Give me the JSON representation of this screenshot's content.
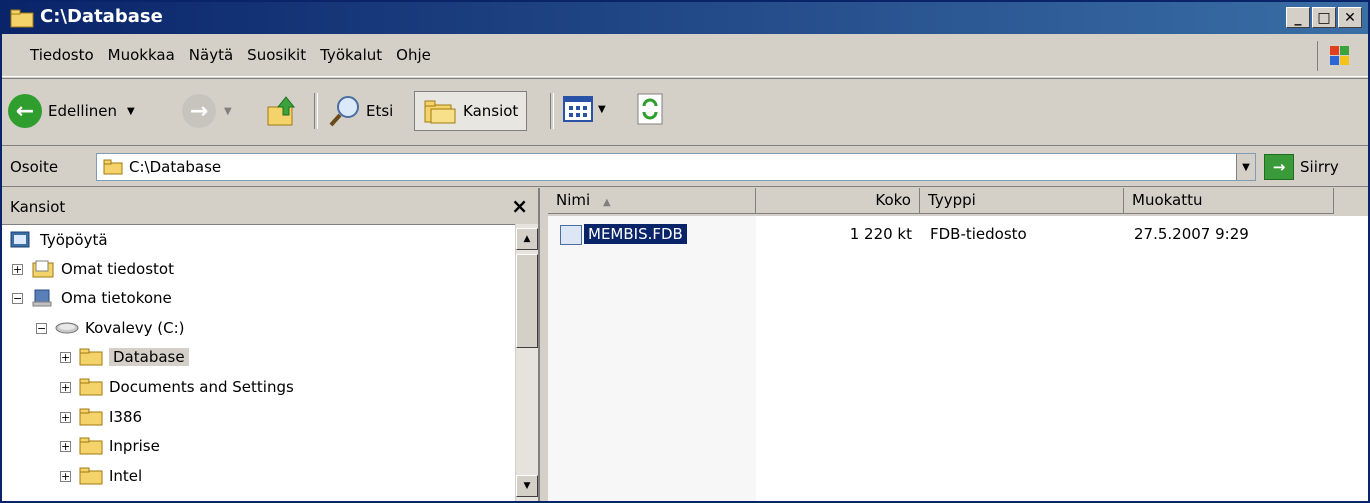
{
  "window": {
    "title": "C:\\Database"
  },
  "menu": [
    "Tiedosto",
    "Muokkaa",
    "Näytä",
    "Suosikit",
    "Työkalut",
    "Ohje"
  ],
  "toolbar": {
    "back_label": "Edellinen",
    "search_label": "Etsi",
    "folders_label": "Kansiot"
  },
  "address": {
    "label": "Osoite",
    "value": "C:\\Database",
    "go_label": "Siirry"
  },
  "folders_pane": {
    "title": "Kansiot",
    "tree": [
      {
        "label": "Työpöytä"
      },
      {
        "label": "Omat tiedostot"
      },
      {
        "label": "Oma tietokone"
      },
      {
        "label": "Kovalevy (C:)"
      },
      {
        "label": "Database"
      },
      {
        "label": "Documents and Settings"
      },
      {
        "label": "I386"
      },
      {
        "label": "Inprise"
      },
      {
        "label": "Intel"
      }
    ]
  },
  "list": {
    "columns": [
      "Nimi",
      "Koko",
      "Tyyppi",
      "Muokattu"
    ],
    "rows": [
      {
        "name": "MEMBIS.FDB",
        "size": "1 220 kt",
        "type": "FDB-tiedosto",
        "modified": "27.5.2007 9:29"
      }
    ]
  },
  "colors": {
    "title_bar": "#0a246a",
    "selection": "#0a246a",
    "face": "#d4d0c8"
  }
}
